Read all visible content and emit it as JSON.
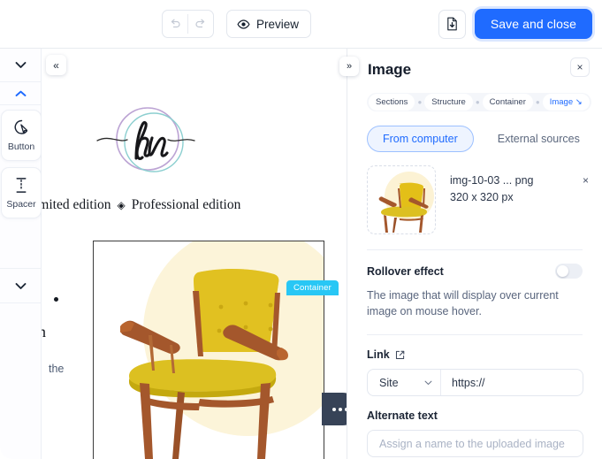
{
  "toolbar": {
    "undo_icon": "undo-arrow-icon",
    "redo_icon": "redo-arrow-icon",
    "preview_label": "Preview",
    "preview_icon": "eye-icon",
    "save_draft_icon": "save-file-icon",
    "save_label": "Save and close",
    "accent_color": "#1f6bff"
  },
  "sidebar": {
    "collapse_label": "«",
    "chevron_down": "⌄",
    "chevron_up": "⌃",
    "tools": [
      {
        "label": "Button",
        "icon": "cursor-click-icon"
      },
      {
        "label": "Spacer",
        "icon": "spacer-icon"
      }
    ]
  },
  "canvas": {
    "logo_alt": "hn monogram logo",
    "hero_text_left": "imited edition",
    "hero_diamond": "◈",
    "hero_text_right": "Professional edition",
    "container_badge": "Container",
    "badge_color": "#28c7f5",
    "side_text_a": "n",
    "side_text_b": "the",
    "more_button": "more-options-button",
    "image_alt": "yellow mid-century armchair"
  },
  "panel": {
    "expand_label": "»",
    "title": "Image",
    "close_label": "×",
    "breadcrumbs": [
      {
        "label": "Sections",
        "active": false
      },
      {
        "label": "Structure",
        "active": false
      },
      {
        "label": "Container",
        "active": false
      },
      {
        "label": "Image ↘",
        "active": true
      }
    ],
    "source_tabs": [
      {
        "label": "From computer",
        "selected": true
      },
      {
        "label": "External sources",
        "selected": false
      }
    ],
    "file": {
      "name": "img-10-03 ... png",
      "size": "320 x 320 px",
      "remove_label": "×"
    },
    "rollover": {
      "label": "Rollover effect",
      "enabled": false,
      "description": "The image that will display over current image on mouse hover."
    },
    "link": {
      "label": "Link",
      "external_icon": "external-link-icon",
      "select_value": "Site",
      "input_value": "https://"
    },
    "alternate": {
      "label": "Alternate text",
      "placeholder": "Assign a name to the uploaded image"
    }
  }
}
